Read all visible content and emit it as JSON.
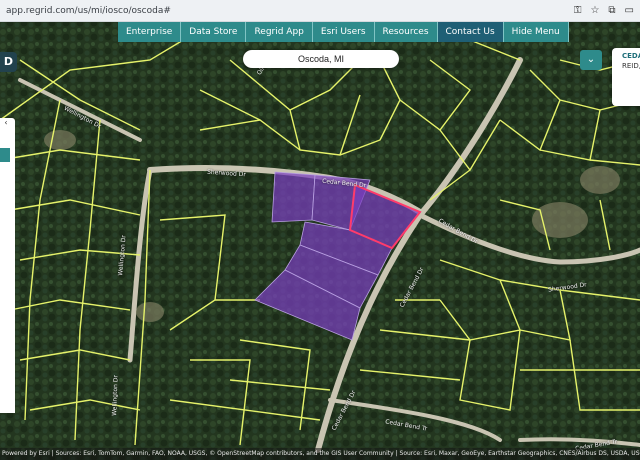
{
  "browser": {
    "url": "app.regrid.com/us/mi/iosco/oscoda#",
    "icons": [
      "key-icon",
      "star-icon",
      "extension-icon",
      "sidebar-icon"
    ]
  },
  "nav": {
    "items": [
      "Enterprise",
      "Data Store",
      "Regrid App",
      "Esri Users",
      "Resources",
      "Contact Us",
      "Hide Menu"
    ],
    "active_index": 5
  },
  "search": {
    "value": "Oscoda, MI"
  },
  "left": {
    "top_button": "D",
    "tab_glyph": "‹"
  },
  "right": {
    "chevron": "⌄",
    "card_line1": "CEDA",
    "card_line2": "REID,"
  },
  "streets": {
    "sherwood_left": "Sherwood Dr",
    "sherwood_right": "Sherwood Dr",
    "cedar_bend_center": "Cedar Bend Dr",
    "cedar_bend_lower": "Cedar Bend Dr",
    "cedar_bend_bottom": "Cedar Bend Tr",
    "cedar_bend_bottom_right": "Cedar Bend Tr",
    "cedar_top": "Cedar Bend Dr",
    "wellington_left": "Wellington Dr",
    "wellington_lower": "Wellington Dr",
    "wellington_top": "Wellington Dr",
    "top_center": "Oliver",
    "parcel_label": "Cedar Bend Dr"
  },
  "attribution": "Powered by Esri | Sources: Esri, TomTom, Garmin, FAO, NOAA, USGS, © OpenStreetMap contributors, and the GIS User Community | Source: Esri, Maxar, GeoEye, Earthstar Geographics, CNES/Airbus DS, USDA, USGS, AeroGRID, IGN"
}
